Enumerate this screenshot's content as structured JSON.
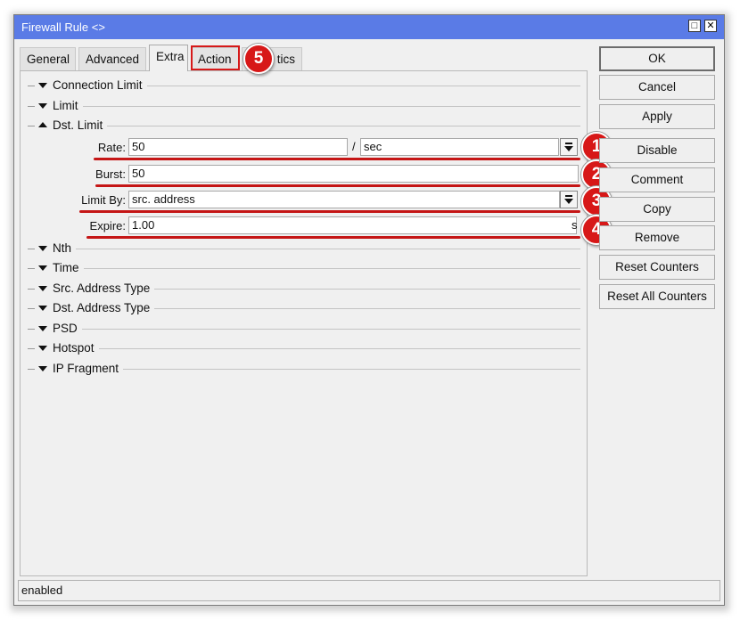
{
  "window": {
    "title": "Firewall Rule <>",
    "restore_glyph": "□",
    "close_glyph": "✕"
  },
  "tabs": [
    {
      "label": "General",
      "active": false
    },
    {
      "label": "Advanced",
      "active": false
    },
    {
      "label": "Extra",
      "active": true
    },
    {
      "label": "Action",
      "active": false
    },
    {
      "label": "tics",
      "active": false
    }
  ],
  "sections": [
    {
      "label": "Connection Limit",
      "expanded": false
    },
    {
      "label": "Limit",
      "expanded": false
    },
    {
      "label": "Dst. Limit",
      "expanded": true
    },
    {
      "label": "Nth",
      "expanded": false
    },
    {
      "label": "Time",
      "expanded": false
    },
    {
      "label": "Src. Address Type",
      "expanded": false
    },
    {
      "label": "Dst. Address Type",
      "expanded": false
    },
    {
      "label": "PSD",
      "expanded": false
    },
    {
      "label": "Hotspot",
      "expanded": false
    },
    {
      "label": "IP Fragment",
      "expanded": false
    }
  ],
  "dst_limit": {
    "rate_label": "Rate:",
    "rate_value": "50",
    "rate_separator": "/",
    "rate_unit": "sec",
    "burst_label": "Burst:",
    "burst_value": "50",
    "limit_by_label": "Limit By:",
    "limit_by_value": "src. address",
    "expire_label": "Expire:",
    "expire_value": "1.00",
    "expire_unit": "s"
  },
  "annotations": [
    "1",
    "2",
    "3",
    "4",
    "5"
  ],
  "annotation_color": "#d71818",
  "buttons": [
    "OK",
    "Cancel",
    "Apply",
    "Disable",
    "Comment",
    "Copy",
    "Remove",
    "Reset Counters",
    "Reset All Counters"
  ],
  "status": "enabled"
}
